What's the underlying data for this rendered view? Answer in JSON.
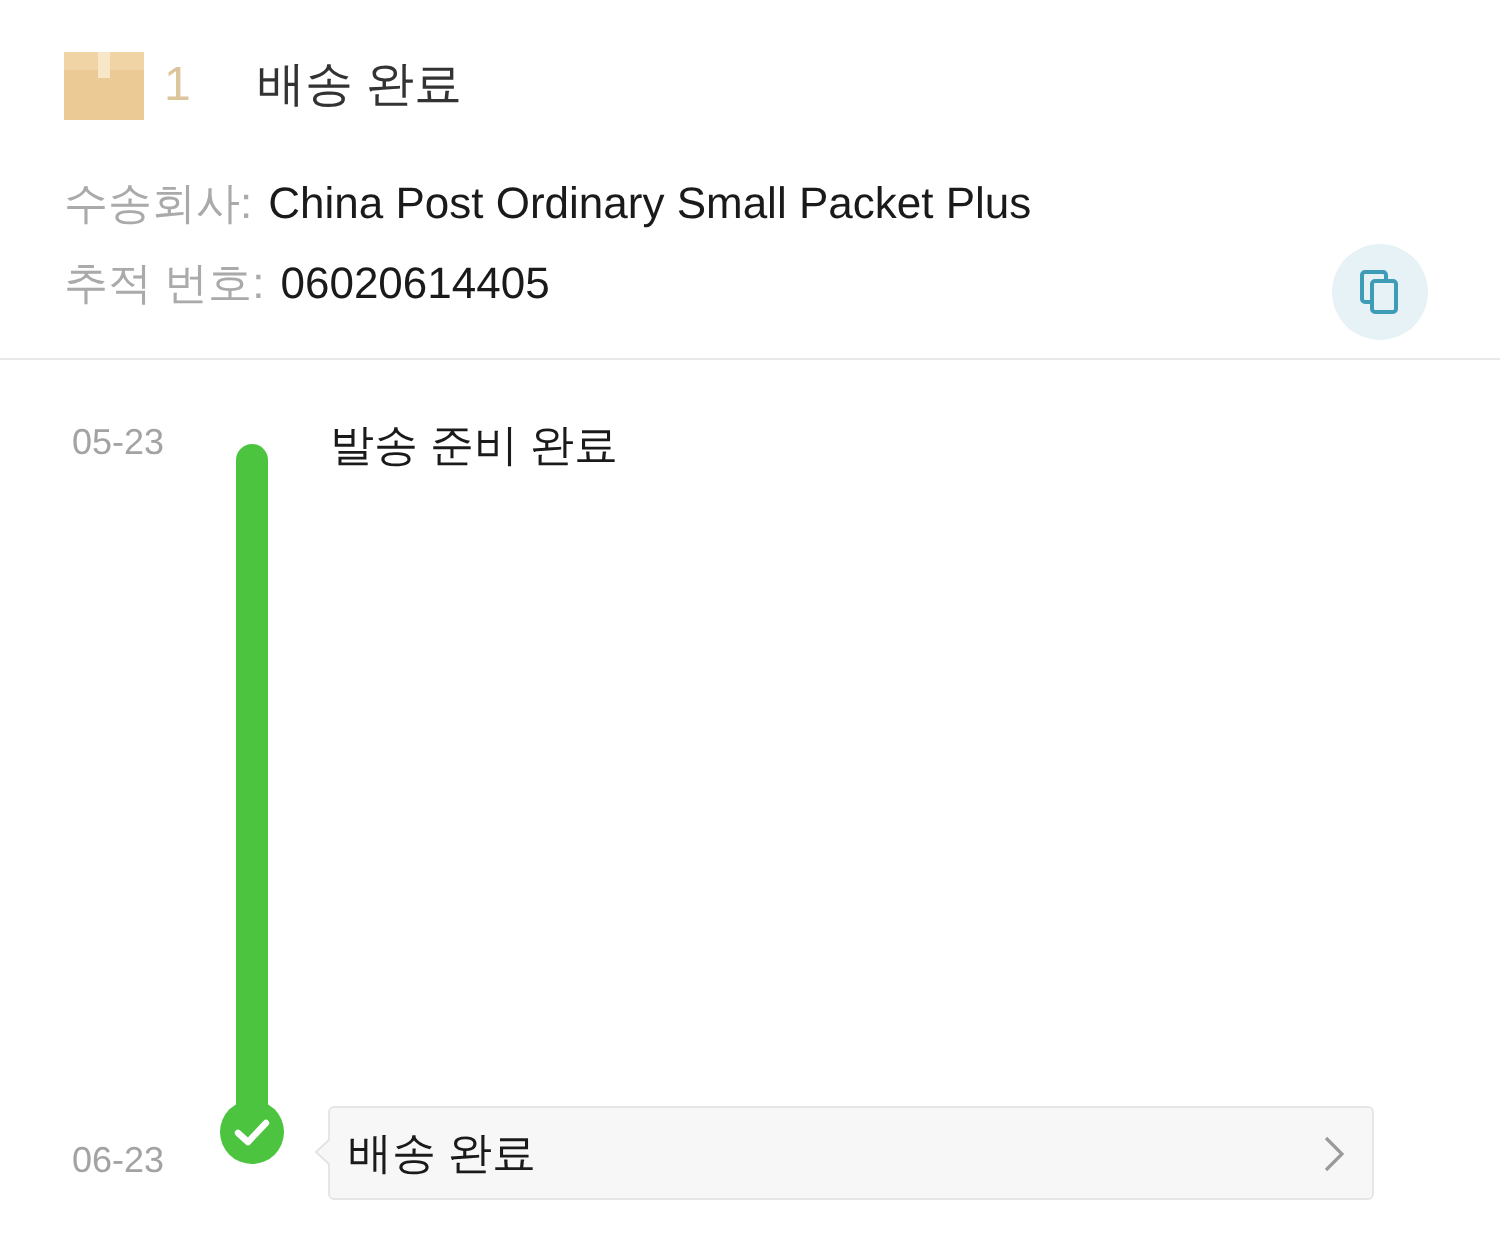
{
  "package": {
    "count": "1",
    "status": "배송 완료"
  },
  "details": [
    {
      "label": "수송회사:",
      "value": "China Post Ordinary Small Packet Plus"
    },
    {
      "label": "추적 번호:",
      "value": "06020614405"
    }
  ],
  "timeline": [
    {
      "date": "05-23",
      "text": "발송 준비 완료",
      "kind": "text"
    },
    {
      "date": "06-23",
      "text": "배송 완료",
      "kind": "card"
    }
  ]
}
